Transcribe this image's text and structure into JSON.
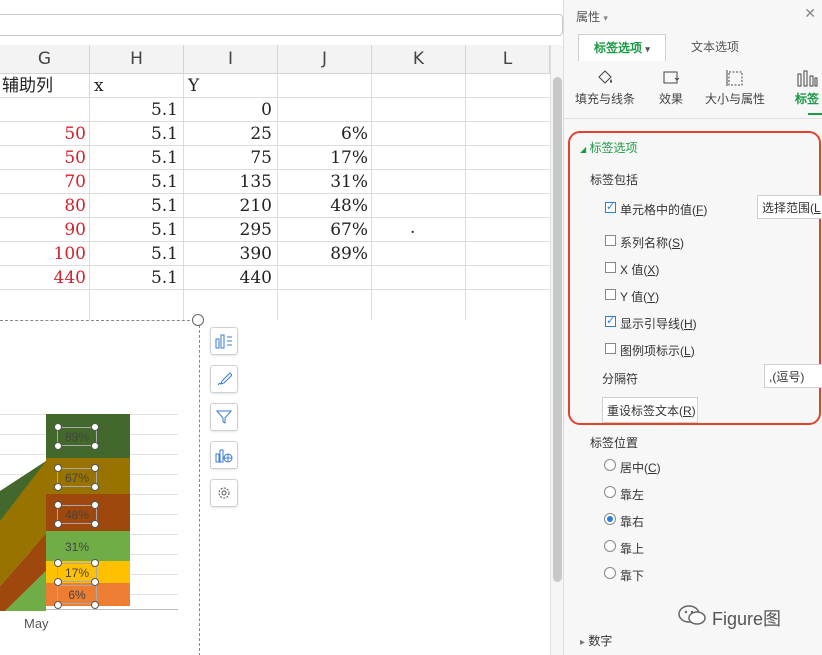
{
  "columns": [
    "G",
    "H",
    "I",
    "J",
    "K",
    "L"
  ],
  "rows": [
    {
      "g": "辅助列",
      "h": "x",
      "i": "Y",
      "j": ""
    },
    {
      "g": "",
      "h": "5.1",
      "i": "0",
      "j": ""
    },
    {
      "g": "50",
      "h": "5.1",
      "i": "25",
      "j": "6%"
    },
    {
      "g": "50",
      "h": "5.1",
      "i": "75",
      "j": "17%"
    },
    {
      "g": "70",
      "h": "5.1",
      "i": "135",
      "j": "31%"
    },
    {
      "g": "80",
      "h": "5.1",
      "i": "210",
      "j": "48%"
    },
    {
      "g": "90",
      "h": "5.1",
      "i": "295",
      "j": "67%"
    },
    {
      "g": "100",
      "h": "5.1",
      "i": "390",
      "j": "89%"
    },
    {
      "g": "440",
      "h": "5.1",
      "i": "440",
      "j": ""
    }
  ],
  "stray_mark": ".",
  "chart": {
    "x_label": "May",
    "bands": [
      {
        "label": "6%",
        "color": "#ed7d31"
      },
      {
        "label": "17%",
        "color": "#ffc000"
      },
      {
        "label": "31%",
        "color": "#70ad47"
      },
      {
        "label": "48%",
        "color": "#9e480e"
      },
      {
        "label": "67%",
        "color": "#997300"
      },
      {
        "label": "89%",
        "color": "#43682b"
      }
    ]
  },
  "chart_tools": [
    "chart-elements-icon",
    "chart-style-icon",
    "chart-filter-icon",
    "chart-layout-icon",
    "chart-settings-icon"
  ],
  "panel": {
    "title": "属性",
    "title_arrow": "▾",
    "close": "✕",
    "tab_label_options": "标签选项",
    "tab_label_arrow": "▾",
    "tab_text_options": "文本选项",
    "subtabs": [
      "填充与线条",
      "效果",
      "大小与属性",
      "标签"
    ],
    "section_label_options": "标签选项",
    "section_arrow": "◢",
    "label_contains": "标签包括",
    "options": [
      {
        "label": "单元格中的值(",
        "key": "F",
        "end": ")",
        "checked": true
      },
      {
        "label": "系列名称(",
        "key": "S",
        "end": ")",
        "checked": false
      },
      {
        "label": "X 值(",
        "key": "X",
        "end": ")",
        "checked": false
      },
      {
        "label": "Y 值(",
        "key": "Y",
        "end": ")",
        "checked": false
      },
      {
        "label": "显示引导线(",
        "key": "H",
        "end": ")",
        "checked": true
      },
      {
        "label": "图例项标示(",
        "key": "L",
        "end": ")",
        "checked": false
      }
    ],
    "select_range": "选择范围(",
    "select_range_key": "L",
    "separator_label": "分隔符",
    "separator_value": ",(逗号)",
    "reset_button": "重设标签文本(",
    "reset_key": "R",
    "reset_end": ")",
    "position_title": "标签位置",
    "positions": [
      {
        "label": "居中(",
        "key": "C",
        "end": ")",
        "selected": false
      },
      {
        "label": "靠左",
        "key": "",
        "end": "",
        "selected": false
      },
      {
        "label": "靠右",
        "key": "",
        "end": "",
        "selected": true
      },
      {
        "label": "靠上",
        "key": "",
        "end": "",
        "selected": false
      },
      {
        "label": "靠下",
        "key": "",
        "end": "",
        "selected": false
      }
    ],
    "number_section": "数字",
    "number_arrow": "▸"
  },
  "watermark": "Figure图"
}
